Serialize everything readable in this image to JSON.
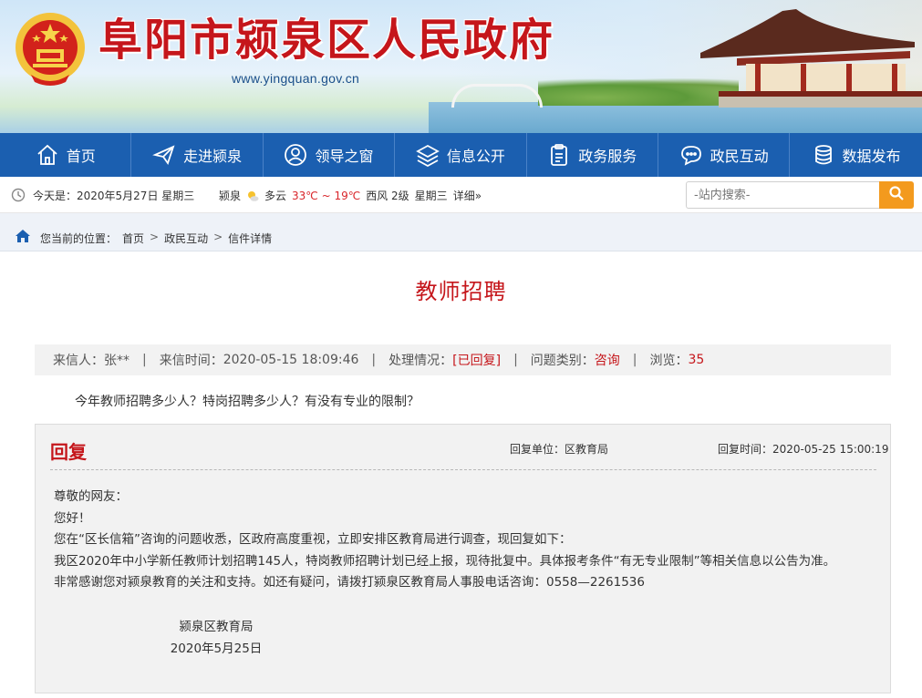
{
  "header": {
    "site_title": "阜阳市颍泉区人民政府",
    "site_url": "www.yingquan.gov.cn"
  },
  "nav": {
    "items": [
      {
        "label": "首页",
        "icon": "home-icon"
      },
      {
        "label": "走进颍泉",
        "icon": "paper-plane-icon"
      },
      {
        "label": "领导之窗",
        "icon": "person-icon"
      },
      {
        "label": "信息公开",
        "icon": "layers-icon"
      },
      {
        "label": "政务服务",
        "icon": "clipboard-icon"
      },
      {
        "label": "政民互动",
        "icon": "chat-icon"
      },
      {
        "label": "数据发布",
        "icon": "database-icon"
      }
    ]
  },
  "infobar": {
    "today": "今天是：2020年5月27日 星期三",
    "city": "颍泉",
    "condition": "多云",
    "temp": "33℃ ~ 19℃",
    "wind": "西风 2级",
    "weekday": "星期三",
    "detail": "详细»"
  },
  "search": {
    "placeholder": "-站内搜索-"
  },
  "breadcrumb": {
    "prefix": "您当前的位置：",
    "items": [
      "首页",
      "政民互动",
      "信件详情"
    ],
    "separator": ">"
  },
  "letter": {
    "title": "教师招聘",
    "sender_label": "来信人：",
    "sender": "张**",
    "time_label": "来信时间：",
    "time": "2020-05-15 18:09:46",
    "status_label": "处理情况：",
    "status": "[已回复]",
    "category_label": "问题类别：",
    "category": "咨询",
    "views_label": "浏览：",
    "views": "35",
    "question": "今年教师招聘多少人？特岗招聘多少人？有没有专业的限制？"
  },
  "reply": {
    "heading": "回复",
    "unit": "回复单位：区教育局",
    "time": "回复时间：2020-05-25 15:00:19",
    "lines": [
      "尊敬的网友：",
      "您好！",
      "您在“区长信箱”咨询的问题收悉，区政府高度重视，立即安排区教育局进行调查，现回复如下：",
      "我区2020年中小学新任教师计划招聘145人，特岗教师招聘计划已经上报，现待批复中。具体报考条件“有无专业限制”等相关信息以公告为准。",
      "非常感谢您对颍泉教育的关注和支持。如还有疑问，请拨打颍泉区教育局人事股电话咨询：0558—2261536"
    ],
    "signature": "颍泉区教育局",
    "date": "2020年5月25日"
  },
  "colors": {
    "brand_red": "#c5161b",
    "nav_blue": "#1b5fb0",
    "search_orange": "#f39a1e"
  }
}
